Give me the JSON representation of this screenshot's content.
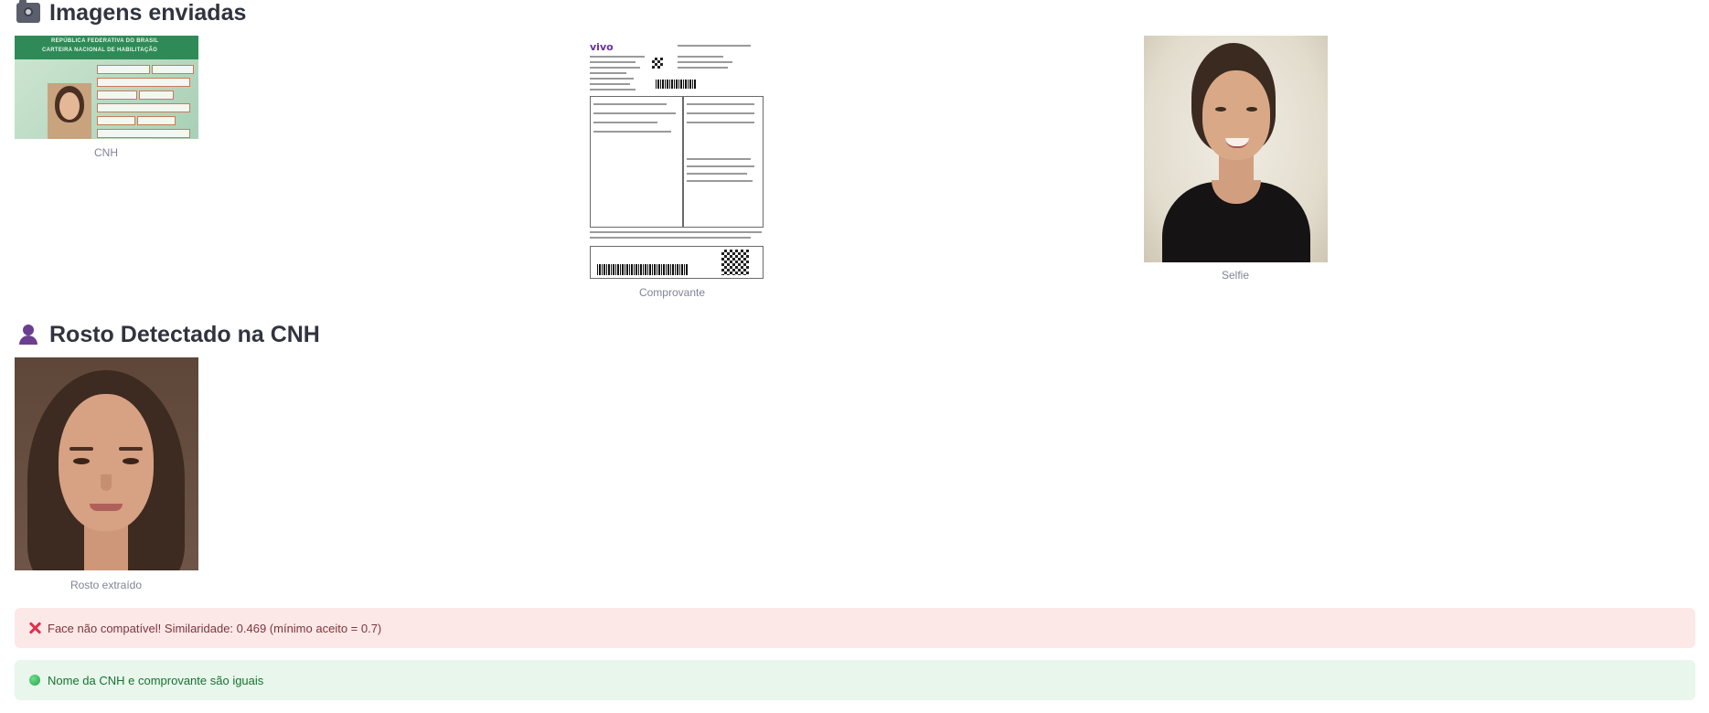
{
  "sections": {
    "uploaded": {
      "title": "Imagens enviadas",
      "icon": "camera-icon",
      "images": [
        {
          "name": "cnh-image",
          "caption": "CNH"
        },
        {
          "name": "comprovante-image",
          "caption": "Comprovante"
        },
        {
          "name": "selfie-image",
          "caption": "Selfie"
        }
      ]
    },
    "detected": {
      "title": "Rosto Detectado na CNH",
      "icon": "person-icon",
      "caption": "Rosto extraído"
    }
  },
  "cnh_text": {
    "header": "REPÚBLICA FEDERATIVA DO BRASIL",
    "subheader": "CARTEIRA NACIONAL DE HABILITAÇÃO"
  },
  "comprovante_text": {
    "logo": "vivo"
  },
  "alerts": {
    "error": "Face não compatível! Similaridade: 0.469 (mínimo aceito = 0.7)",
    "success": "Nome da CNH e comprovante são iguais"
  },
  "colors": {
    "error_bg": "#fde8e8",
    "error_text": "#7d353b",
    "success_bg": "#e8f6ec",
    "success_text": "#177233"
  }
}
